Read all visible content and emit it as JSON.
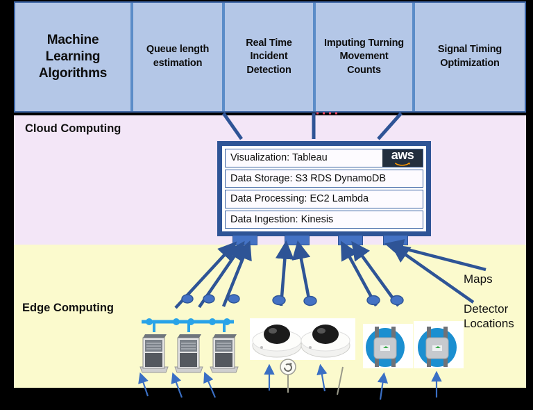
{
  "bands": {
    "cloud_label": "Cloud Computing",
    "edge_label": "Edge Computing"
  },
  "ml_band": {
    "title": "Machine Learning Algorithms",
    "title_lines": [
      "Machine",
      "Learning",
      "Algorithms"
    ],
    "applications": [
      {
        "label": "Queue length estimation",
        "lines": [
          "Queue length",
          "estimation"
        ]
      },
      {
        "label": "Real Time Incident Detection",
        "lines": [
          "Real Time",
          "Incident",
          "Detection"
        ]
      },
      {
        "label": "Imputing Turning Movement Counts",
        "lines": [
          "Imputing Turning",
          "Movement",
          "Counts"
        ]
      },
      {
        "label": "Signal Timing Optimization",
        "lines": [
          "Signal Timing",
          "Optimization"
        ]
      }
    ]
  },
  "aws_stack": {
    "logo_text": "aws",
    "rows": [
      "Visualization:  Tableau",
      "Data Storage: S3 RDS DynamoDB",
      "Data Processing: EC2  Lambda",
      "Data Ingestion: Kinesis"
    ]
  },
  "side_labels": {
    "maps": "Maps",
    "detector_locations": "Detector Locations",
    "detector_lines": [
      "Detector",
      "Locations"
    ]
  },
  "edge_devices": [
    {
      "name": "traffic-signal-controller-cabinet"
    },
    {
      "name": "traffic-signal-controller-cabinet"
    },
    {
      "name": "traffic-signal-controller-cabinet"
    },
    {
      "name": "dome-camera"
    },
    {
      "name": "dome-camera"
    },
    {
      "name": "radar-detector"
    },
    {
      "name": "radar-detector"
    }
  ],
  "colors": {
    "ml_band_fill": "#b4c7e7",
    "ml_band_border": "#3c64a4",
    "cloud_fill": "#f3e6f7",
    "edge_fill": "#fbfacd",
    "connector": "#2e5496",
    "aws_navy": "#232f3e",
    "aws_orange": "#ff9900",
    "bus_line": "#29a3e8",
    "radar_blue": "#1b8fd0"
  }
}
